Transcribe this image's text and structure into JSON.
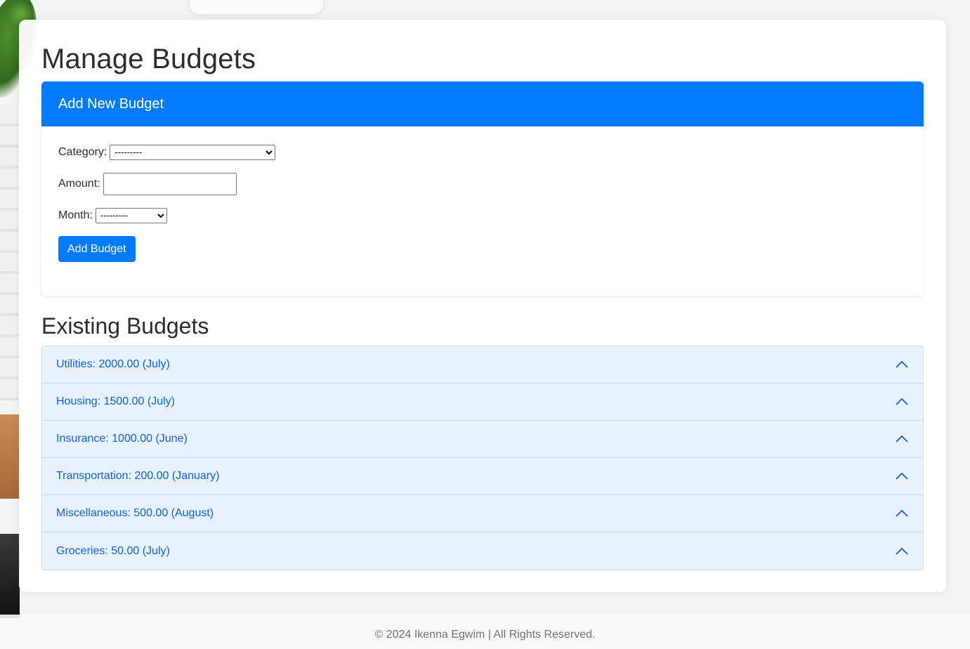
{
  "page": {
    "title": "Manage Budgets"
  },
  "add_card": {
    "header": "Add New Budget",
    "category_label": "Category:",
    "category_selected": "---------",
    "amount_label": "Amount:",
    "amount_value": "",
    "month_label": "Month:",
    "month_selected": "---------",
    "submit_label": "Add Budget"
  },
  "existing": {
    "title": "Existing Budgets",
    "items": [
      {
        "label": "Utilities: 2000.00 (July)"
      },
      {
        "label": "Housing: 1500.00 (July)"
      },
      {
        "label": "Insurance: 1000.00 (June)"
      },
      {
        "label": "Transportation: 200.00 (January)"
      },
      {
        "label": "Miscellaneous: 500.00 (August)"
      },
      {
        "label": "Groceries: 50.00 (July)"
      }
    ]
  },
  "footer": {
    "text": "© 2024 Ikenna Egwim | All Rights Reserved."
  },
  "colors": {
    "primary": "#007bff",
    "accordion_bg": "#e7f1ff",
    "accordion_text": "#0c63e4"
  },
  "icons": {
    "accordion_toggle": "chevron-up-icon"
  }
}
